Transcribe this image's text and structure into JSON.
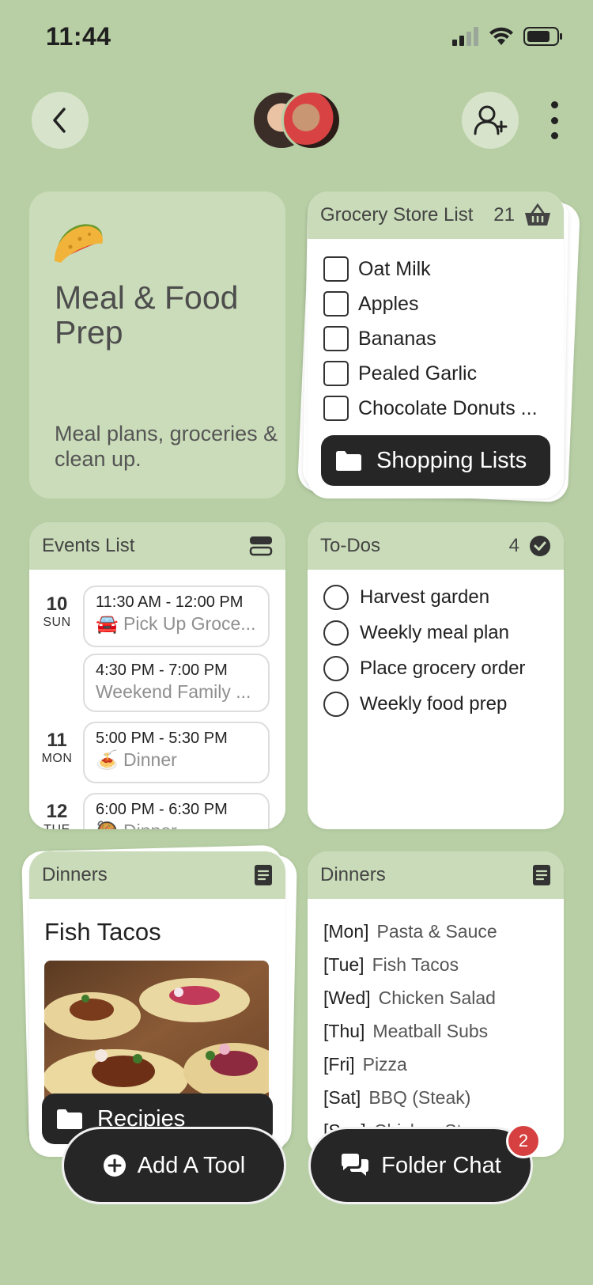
{
  "status": {
    "time": "11:44"
  },
  "meal": {
    "title": "Meal & Food Prep",
    "subtitle": "Meal plans, groceries & clean up."
  },
  "grocery": {
    "title": "Grocery Store List",
    "count": "21",
    "items": [
      "Oat Milk",
      "Apples",
      "Bananas",
      "Pealed Garlic",
      "Chocolate Donuts ..."
    ],
    "folder_label": "Shopping Lists"
  },
  "events": {
    "title": "Events List",
    "days": [
      {
        "num": "10",
        "dow": "SUN"
      },
      {
        "num": "11",
        "dow": "MON"
      },
      {
        "num": "12",
        "dow": "TUE"
      }
    ],
    "items": [
      {
        "time": "11:30 AM - 12:00 PM",
        "name": "🚘 Pick Up Groce..."
      },
      {
        "time": "4:30 PM - 7:00 PM",
        "name": "Weekend Family ..."
      },
      {
        "time": "5:00 PM - 5:30 PM",
        "name": "🍝 Dinner"
      },
      {
        "time": "6:00 PM - 6:30 PM",
        "name": "🥘 Dinner"
      }
    ]
  },
  "todos": {
    "title": "To-Dos",
    "count": "4",
    "items": [
      "Harvest garden",
      "Weekly meal plan",
      "Place grocery order",
      "Weekly food prep"
    ]
  },
  "recipe": {
    "title": "Dinners",
    "dish": "Fish Tacos",
    "folder_label": "Recipies"
  },
  "dinners": {
    "title": "Dinners",
    "rows": [
      {
        "day": "[Mon]",
        "meal": "Pasta & Sauce"
      },
      {
        "day": "[Tue]",
        "meal": "Fish Tacos"
      },
      {
        "day": "[Wed]",
        "meal": "Chicken Salad"
      },
      {
        "day": "[Thu]",
        "meal": "Meatball Subs"
      },
      {
        "day": "[Fri]",
        "meal": "Pizza"
      },
      {
        "day": "[Sat]",
        "meal": "BBQ (Steak)"
      },
      {
        "day": "[Sun]",
        "meal": "Chicken Stew"
      }
    ]
  },
  "actions": {
    "add_tool": "Add A Tool",
    "folder_chat": "Folder Chat",
    "chat_badge": "2"
  },
  "colors": {
    "background": "#b8cfa5",
    "card_header": "#c9dbb8",
    "dark": "#262626",
    "badge": "#d64040"
  }
}
